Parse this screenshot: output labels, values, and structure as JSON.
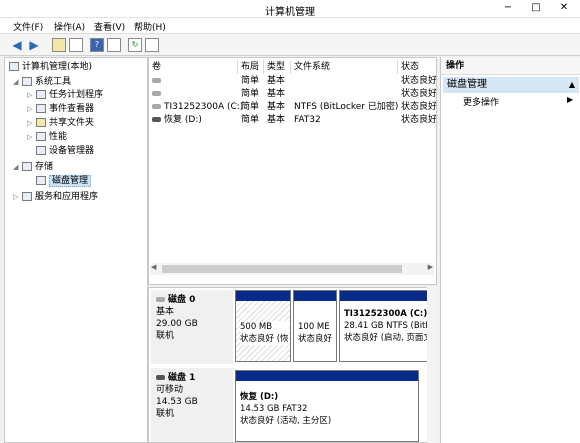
{
  "window": {
    "title": "计算机管理",
    "minimize": "−",
    "maximize": "□",
    "close": "✕"
  },
  "menu": [
    "文件(F)",
    "操作(A)",
    "查看(V)",
    "帮助(H)"
  ],
  "toolbar": {
    "back_icon": "◀",
    "forward_icon": "▶"
  },
  "tree": {
    "root": "计算机管理(本地)",
    "system_tools": "系统工具",
    "task_scheduler": "任务计划程序",
    "event_viewer": "事件查看器",
    "shared_folders": "共享文件夹",
    "performance": "性能",
    "device_manager": "设备管理器",
    "storage": "存储",
    "disk_management": "磁盘管理",
    "services_apps": "服务和应用程序"
  },
  "volume_list": {
    "columns": [
      "卷",
      "布局",
      "类型",
      "文件系统",
      "状态"
    ],
    "rows": [
      {
        "name": "",
        "layout": "简单",
        "type": "基本",
        "fs": "",
        "status": "状态良好"
      },
      {
        "name": "",
        "layout": "简单",
        "type": "基本",
        "fs": "",
        "status": "状态良好"
      },
      {
        "name": "TI31252300A (C:)",
        "layout": "简单",
        "type": "基本",
        "fs": "NTFS (BitLocker 已加密)",
        "status": "状态良好"
      },
      {
        "name": "恢复 (D:)",
        "layout": "简单",
        "type": "基本",
        "fs": "FAT32",
        "status": "状态良好"
      }
    ]
  },
  "disk0": {
    "name": "磁盘 0",
    "type": "基本",
    "size": "29.00 GB",
    "state": "联机",
    "partitions": [
      {
        "size": "500 MB",
        "status": "状态良好 (恢"
      },
      {
        "size": "100 ME",
        "status": "状态良好"
      },
      {
        "name": "TI31252300A  (C:)",
        "size": "28.41 GB NTFS (BitLoc",
        "status": "状态良好 (启动, 页面文"
      }
    ]
  },
  "disk1": {
    "name": "磁盘 1",
    "type": "可移动",
    "size": "14.53 GB",
    "state": "联机",
    "partition": {
      "name": "恢复  (D:)",
      "size": "14.53 GB FAT32",
      "status": "状态良好 (活动, 主分区)"
    }
  },
  "actions": {
    "header": "操作",
    "section": "磁盘管理",
    "more": "更多操作"
  }
}
